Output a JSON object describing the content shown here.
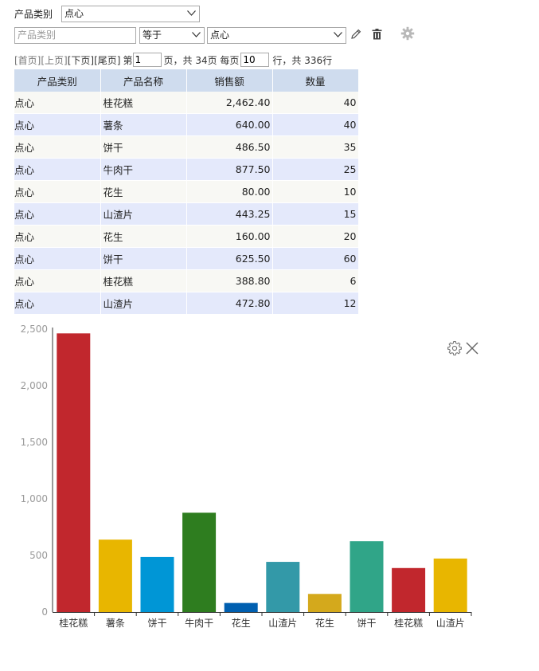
{
  "filter": {
    "category_label": "产品类别",
    "category_value": "点心",
    "field_placeholder": "产品类别",
    "operator_value": "等于",
    "value_select": "点心"
  },
  "pager": {
    "first": "[首页]",
    "prev": "[上页]",
    "next": "[下页]",
    "last": "[尾页]",
    "page_prefix": "第",
    "page_value": "1",
    "page_suffix": "页，共 34页 每页",
    "size_value": "10",
    "size_suffix": "行，共 336行"
  },
  "table": {
    "headers": [
      "产品类别",
      "产品名称",
      "销售额",
      "数量"
    ],
    "rows": [
      [
        "点心",
        "桂花糕",
        "2,462.40",
        "40"
      ],
      [
        "点心",
        "薯条",
        "640.00",
        "40"
      ],
      [
        "点心",
        "饼干",
        "486.50",
        "35"
      ],
      [
        "点心",
        "牛肉干",
        "877.50",
        "25"
      ],
      [
        "点心",
        "花生",
        "80.00",
        "10"
      ],
      [
        "点心",
        "山渣片",
        "443.25",
        "15"
      ],
      [
        "点心",
        "花生",
        "160.00",
        "20"
      ],
      [
        "点心",
        "饼干",
        "625.50",
        "60"
      ],
      [
        "点心",
        "桂花糕",
        "388.80",
        "6"
      ],
      [
        "点心",
        "山渣片",
        "472.80",
        "12"
      ]
    ]
  },
  "chart_data": {
    "type": "bar",
    "categories": [
      "桂花糕",
      "薯条",
      "饼干",
      "牛肉干",
      "花生",
      "山渣片",
      "花生",
      "饼干",
      "桂花糕",
      "山渣片"
    ],
    "values": [
      2462.4,
      640.0,
      486.5,
      877.5,
      80.0,
      443.25,
      160.0,
      625.5,
      388.8,
      472.8
    ],
    "colors": [
      "#c1272d",
      "#e8b600",
      "#0096d6",
      "#2e7d1f",
      "#005fb0",
      "#3399a8",
      "#d4a91c",
      "#30a588",
      "#c1272d",
      "#e8b600"
    ],
    "ylim": [
      0,
      2500
    ],
    "yticks": [
      "0",
      "500",
      "1,000",
      "1,500",
      "2,000",
      "2,500"
    ],
    "grid": false,
    "title": "",
    "xlabel": "",
    "ylabel": ""
  },
  "icons": [
    "chevron-down-icon",
    "pencil-icon",
    "trash-icon",
    "gear-icon",
    "close-icon"
  ]
}
